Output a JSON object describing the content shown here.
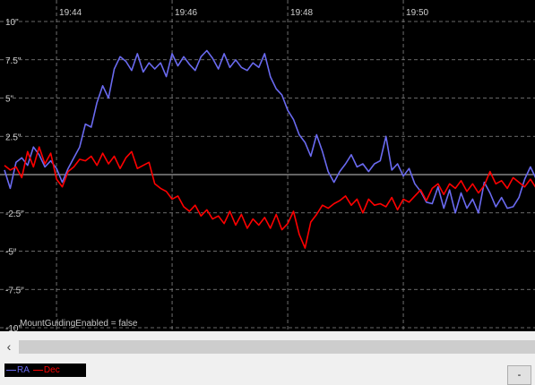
{
  "window": {
    "status_text": "MountGuidingEnabled = false"
  },
  "x_ticks": [
    "19:44",
    "19:46",
    "19:48",
    "19:50"
  ],
  "y_ticks": [
    "10\"",
    "7.5\"",
    "5\"",
    "2.5\"",
    "-2.5\"",
    "-5\"",
    "-7.5\"",
    "-10\""
  ],
  "legend": {
    "ra_label": "RA",
    "dec_label": "Dec"
  },
  "controls": {
    "minus_label": "-",
    "scroll_left_icon": "‹"
  },
  "colors": {
    "ra": "#6a6af0",
    "dec": "#ff0000",
    "grid": "#8a8a8a",
    "background": "#000000"
  },
  "chart_data": {
    "type": "line",
    "xlabel": "",
    "ylabel": "",
    "ylim": [
      -10,
      10
    ],
    "x_unit": "minutes from 19:43.1",
    "xlim": [
      0,
      9.3
    ],
    "x_tick_values": [
      0.9,
      2.9,
      4.9,
      6.9
    ],
    "series": [
      {
        "name": "RA",
        "points": [
          [
            0,
            0.3
          ],
          [
            0.1,
            -0.9
          ],
          [
            0.2,
            0.8
          ],
          [
            0.3,
            1.1
          ],
          [
            0.4,
            0.6
          ],
          [
            0.5,
            1.8
          ],
          [
            0.6,
            1.3
          ],
          [
            0.7,
            0.5
          ],
          [
            0.8,
            0.9
          ],
          [
            0.9,
            0.4
          ],
          [
            1.0,
            -0.5
          ],
          [
            1.1,
            0.4
          ],
          [
            1.2,
            1.1
          ],
          [
            1.3,
            1.8
          ],
          [
            1.4,
            3.3
          ],
          [
            1.5,
            3.1
          ],
          [
            1.6,
            4.7
          ],
          [
            1.7,
            5.8
          ],
          [
            1.8,
            5.0
          ],
          [
            1.9,
            6.9
          ],
          [
            2.0,
            7.7
          ],
          [
            2.1,
            7.4
          ],
          [
            2.2,
            6.8
          ],
          [
            2.3,
            7.9
          ],
          [
            2.4,
            6.7
          ],
          [
            2.5,
            7.3
          ],
          [
            2.6,
            6.9
          ],
          [
            2.7,
            7.3
          ],
          [
            2.8,
            6.4
          ],
          [
            2.9,
            7.9
          ],
          [
            3.0,
            7.1
          ],
          [
            3.1,
            7.7
          ],
          [
            3.2,
            7.2
          ],
          [
            3.3,
            6.8
          ],
          [
            3.4,
            7.7
          ],
          [
            3.5,
            8.1
          ],
          [
            3.6,
            7.6
          ],
          [
            3.7,
            6.9
          ],
          [
            3.8,
            7.9
          ],
          [
            3.9,
            7.0
          ],
          [
            4.0,
            7.5
          ],
          [
            4.1,
            7.0
          ],
          [
            4.2,
            6.8
          ],
          [
            4.3,
            7.3
          ],
          [
            4.4,
            7.0
          ],
          [
            4.5,
            7.9
          ],
          [
            4.6,
            6.4
          ],
          [
            4.7,
            5.6
          ],
          [
            4.8,
            5.2
          ],
          [
            4.9,
            4.2
          ],
          [
            5.0,
            3.6
          ],
          [
            5.1,
            2.6
          ],
          [
            5.2,
            2.1
          ],
          [
            5.3,
            1.2
          ],
          [
            5.4,
            2.6
          ],
          [
            5.5,
            1.5
          ],
          [
            5.6,
            0.2
          ],
          [
            5.7,
            -0.5
          ],
          [
            5.8,
            0.2
          ],
          [
            5.9,
            0.7
          ],
          [
            6.0,
            1.3
          ],
          [
            6.1,
            0.5
          ],
          [
            6.2,
            0.7
          ],
          [
            6.3,
            0.2
          ],
          [
            6.4,
            0.7
          ],
          [
            6.5,
            0.9
          ],
          [
            6.6,
            2.5
          ],
          [
            6.7,
            0.3
          ],
          [
            6.8,
            0.7
          ],
          [
            6.9,
            -0.1
          ],
          [
            7.0,
            0.4
          ],
          [
            7.1,
            -0.6
          ],
          [
            7.2,
            -1.1
          ],
          [
            7.3,
            -1.8
          ],
          [
            7.4,
            -1.9
          ],
          [
            7.5,
            -0.8
          ],
          [
            7.6,
            -2.2
          ],
          [
            7.7,
            -1.0
          ],
          [
            7.8,
            -2.5
          ],
          [
            7.9,
            -1.2
          ],
          [
            8.0,
            -2.2
          ],
          [
            8.1,
            -1.6
          ],
          [
            8.2,
            -2.5
          ],
          [
            8.3,
            -0.5
          ],
          [
            8.4,
            -1.2
          ],
          [
            8.5,
            -2.1
          ],
          [
            8.6,
            -1.5
          ],
          [
            8.7,
            -2.2
          ],
          [
            8.8,
            -2.1
          ],
          [
            8.9,
            -1.5
          ],
          [
            9.0,
            -0.3
          ],
          [
            9.1,
            0.5
          ],
          [
            9.2,
            -0.3
          ],
          [
            9.3,
            -0.6
          ]
        ]
      },
      {
        "name": "Dec",
        "points": [
          [
            0,
            0.6
          ],
          [
            0.1,
            0.3
          ],
          [
            0.2,
            0.5
          ],
          [
            0.3,
            -0.2
          ],
          [
            0.4,
            1.5
          ],
          [
            0.5,
            0.5
          ],
          [
            0.6,
            1.8
          ],
          [
            0.7,
            0.7
          ],
          [
            0.8,
            1.4
          ],
          [
            0.9,
            -0.3
          ],
          [
            1.0,
            -0.8
          ],
          [
            1.1,
            0.2
          ],
          [
            1.2,
            0.5
          ],
          [
            1.3,
            1.0
          ],
          [
            1.4,
            0.9
          ],
          [
            1.5,
            1.2
          ],
          [
            1.6,
            0.6
          ],
          [
            1.7,
            1.4
          ],
          [
            1.8,
            0.7
          ],
          [
            1.9,
            1.2
          ],
          [
            2.0,
            0.4
          ],
          [
            2.1,
            1.1
          ],
          [
            2.2,
            1.5
          ],
          [
            2.3,
            0.4
          ],
          [
            2.4,
            0.6
          ],
          [
            2.5,
            0.8
          ],
          [
            2.6,
            -0.6
          ],
          [
            2.7,
            -0.9
          ],
          [
            2.8,
            -1.1
          ],
          [
            2.9,
            -1.6
          ],
          [
            3.0,
            -1.4
          ],
          [
            3.1,
            -2.1
          ],
          [
            3.2,
            -2.4
          ],
          [
            3.3,
            -2.0
          ],
          [
            3.4,
            -2.7
          ],
          [
            3.5,
            -2.3
          ],
          [
            3.6,
            -2.9
          ],
          [
            3.7,
            -2.7
          ],
          [
            3.8,
            -3.2
          ],
          [
            3.9,
            -2.4
          ],
          [
            4.0,
            -3.3
          ],
          [
            4.1,
            -2.6
          ],
          [
            4.2,
            -3.5
          ],
          [
            4.3,
            -2.9
          ],
          [
            4.4,
            -3.3
          ],
          [
            4.5,
            -2.8
          ],
          [
            4.6,
            -3.5
          ],
          [
            4.7,
            -2.6
          ],
          [
            4.8,
            -3.6
          ],
          [
            4.9,
            -3.2
          ],
          [
            5.0,
            -2.4
          ],
          [
            5.1,
            -3.9
          ],
          [
            5.2,
            -4.8
          ],
          [
            5.3,
            -3.1
          ],
          [
            5.4,
            -2.6
          ],
          [
            5.5,
            -2.0
          ],
          [
            5.6,
            -2.2
          ],
          [
            5.7,
            -1.9
          ],
          [
            5.8,
            -1.7
          ],
          [
            5.9,
            -1.4
          ],
          [
            6.0,
            -2.0
          ],
          [
            6.1,
            -1.6
          ],
          [
            6.2,
            -2.5
          ],
          [
            6.3,
            -1.6
          ],
          [
            6.4,
            -2.0
          ],
          [
            6.5,
            -1.9
          ],
          [
            6.6,
            -2.1
          ],
          [
            6.7,
            -1.5
          ],
          [
            6.8,
            -2.3
          ],
          [
            6.9,
            -1.6
          ],
          [
            7.0,
            -1.8
          ],
          [
            7.1,
            -1.4
          ],
          [
            7.2,
            -1.0
          ],
          [
            7.3,
            -1.7
          ],
          [
            7.4,
            -0.9
          ],
          [
            7.5,
            -0.6
          ],
          [
            7.6,
            -1.3
          ],
          [
            7.7,
            -0.6
          ],
          [
            7.8,
            -0.9
          ],
          [
            7.9,
            -0.4
          ],
          [
            8.0,
            -1.1
          ],
          [
            8.1,
            -0.6
          ],
          [
            8.2,
            -1.2
          ],
          [
            8.3,
            -0.7
          ],
          [
            8.4,
            0.2
          ],
          [
            8.5,
            -0.6
          ],
          [
            8.6,
            -0.4
          ],
          [
            8.7,
            -0.9
          ],
          [
            8.8,
            -0.2
          ],
          [
            8.9,
            -0.5
          ],
          [
            9.0,
            -0.8
          ],
          [
            9.1,
            -0.3
          ],
          [
            9.2,
            -0.9
          ],
          [
            9.3,
            -0.7
          ]
        ]
      }
    ]
  }
}
